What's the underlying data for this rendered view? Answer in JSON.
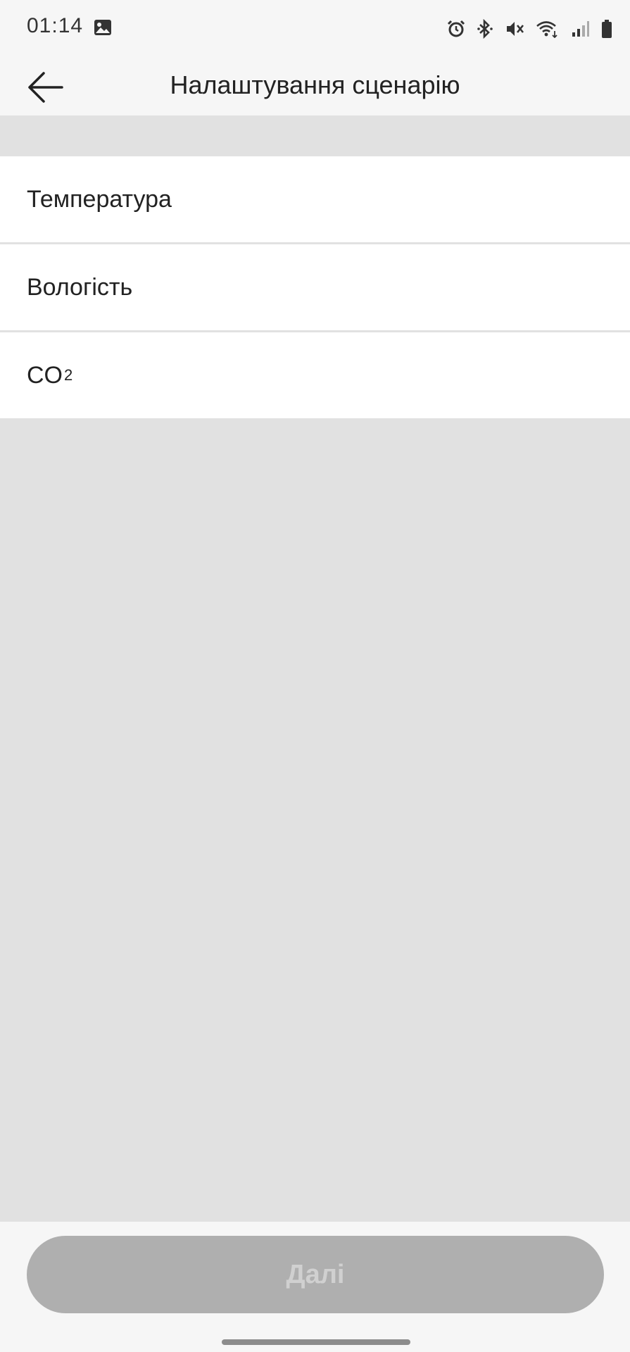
{
  "status_bar": {
    "time": "01:14",
    "icons": [
      "gallery-icon",
      "alarm-icon",
      "bluetooth-icon",
      "mute-icon",
      "wifi-icon",
      "signal-icon",
      "battery-icon"
    ]
  },
  "app_bar": {
    "title": "Налаштування сценарію",
    "back_icon": "arrow-left-icon"
  },
  "options": [
    {
      "label": "Температура"
    },
    {
      "label": "Вологість"
    },
    {
      "label": "CO",
      "subscript": "2"
    }
  ],
  "next_button": {
    "label": "Далі",
    "enabled": false
  },
  "colors": {
    "background": "#e1e1e1",
    "bar": "#f6f6f6",
    "button_disabled": "#afafaf",
    "button_text_disabled": "#d0d0d0"
  }
}
